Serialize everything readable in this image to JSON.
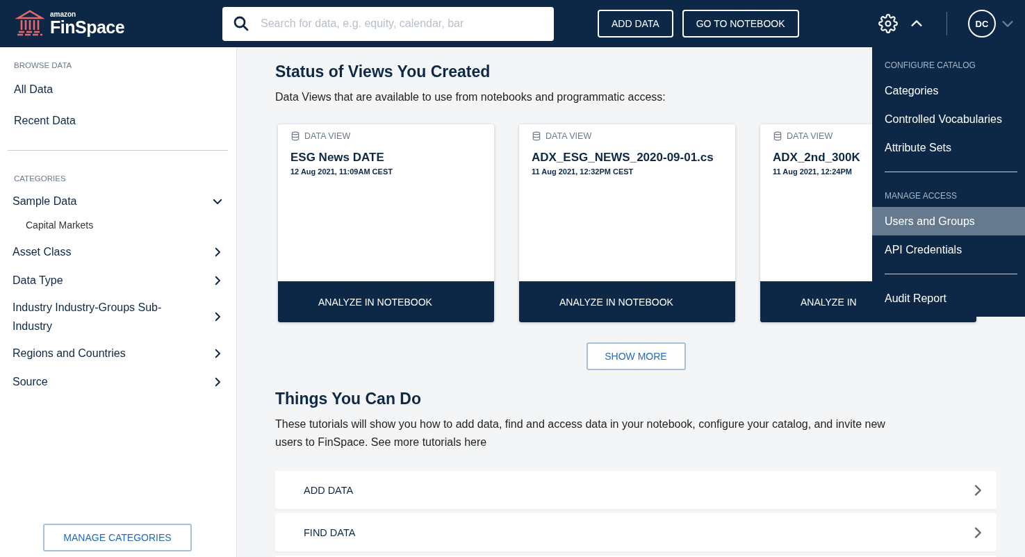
{
  "header": {
    "logo_small": "amazon",
    "logo_name": "FinSpace",
    "search": {
      "placeholder": "Search for data, e.g. equity, calendar, bar"
    },
    "buttons": [
      "ADD DATA",
      "GO TO NOTEBOOK"
    ],
    "settings_open": true,
    "avatar": "DC"
  },
  "sidebar": {
    "browse_heading": "BROWSE DATA",
    "browse_items": [
      "All Data",
      "Recent Data"
    ],
    "categories_heading": "CATEGORIES",
    "categories": [
      {
        "label": "Sample Data",
        "expanded": true,
        "children": [
          {
            "label": "Capital Markets"
          }
        ]
      },
      {
        "label": "Asset Class",
        "expanded": false
      },
      {
        "label": "Data Type",
        "expanded": false
      },
      {
        "label": "Industry Industry-Groups Sub-Industry",
        "expanded": false
      },
      {
        "label": "Regions and Countries",
        "expanded": false
      },
      {
        "label": "Source",
        "expanded": false
      }
    ],
    "manage_button": "MANAGE CATEGORIES"
  },
  "views": {
    "title": "Status of Views You Created",
    "subtitle": "Data Views that are available to use from notebooks and programmatic access:",
    "cards": [
      {
        "type": "DATA VIEW",
        "name": "ESG News DATE",
        "date": "12 Aug 2021, 11:09AM CEST",
        "action": "ANALYZE IN NOTEBOOK"
      },
      {
        "type": "DATA VIEW",
        "name": "ADX_ESG_NEWS_2020-09-01.cs",
        "date": "11 Aug 2021, 12:32PM CEST",
        "action": "ANALYZE IN NOTEBOOK"
      },
      {
        "type": "DATA VIEW",
        "name": "ADX_2nd_300K",
        "date": "11 Aug 2021, 12:24PM",
        "action": "ANALYZE IN"
      }
    ],
    "show_more": "SHOW MORE"
  },
  "tutorials": {
    "title": "Things You Can Do",
    "text": "These tutorials will show you how to add data, find and access data in your notebook, configure your catalog, and invite new users to FinSpace. See more tutorials here",
    "rows": [
      "ADD DATA",
      "FIND DATA"
    ]
  },
  "settings_menu": [
    {
      "kind": "heading",
      "label": "CONFIGURE CATALOG"
    },
    {
      "kind": "item",
      "label": "Categories",
      "selected": false
    },
    {
      "kind": "item",
      "label": "Controlled Vocabularies",
      "selected": false
    },
    {
      "kind": "item",
      "label": "Attribute Sets",
      "selected": false
    },
    {
      "kind": "divider"
    },
    {
      "kind": "heading",
      "label": "MANAGE ACCESS"
    },
    {
      "kind": "item",
      "label": "Users and Groups",
      "selected": true
    },
    {
      "kind": "item",
      "label": "API Credentials",
      "selected": false
    },
    {
      "kind": "divider"
    },
    {
      "kind": "item",
      "label": "Audit Report",
      "selected": false
    }
  ]
}
